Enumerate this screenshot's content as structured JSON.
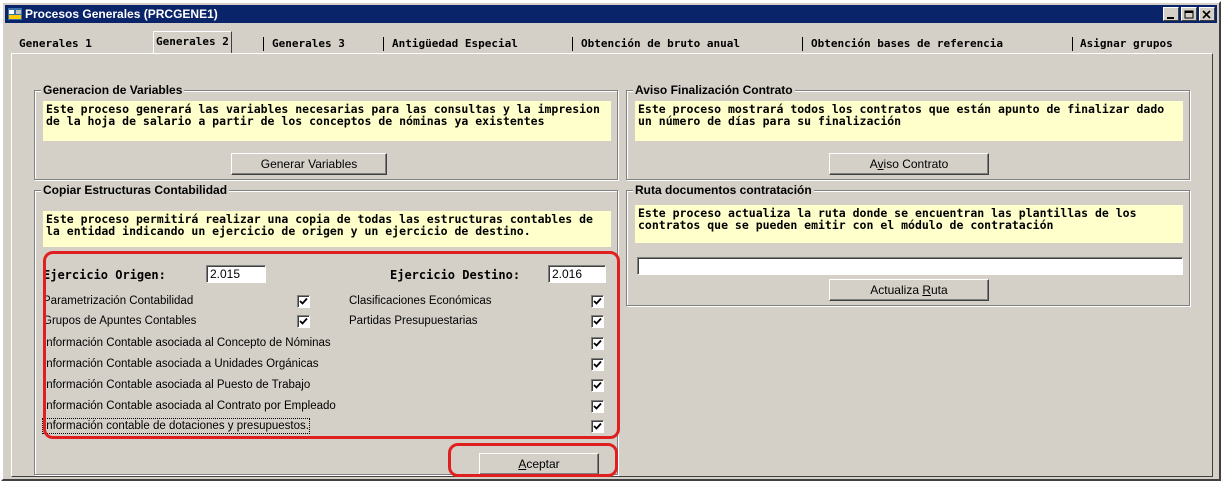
{
  "window": {
    "title": "Procesos Generales (PRCGENE1)"
  },
  "tabs": [
    "Generales 1",
    "Generales 2",
    "Generales 3",
    "Antigüedad Especial",
    "Obtención de bruto anual",
    "Obtención bases de referencia",
    "Asignar grupos"
  ],
  "generacion": {
    "title": "Generacion de Variables",
    "note": "Este proceso generará las variables necesarias para las consultas y la impresion de la hoja de salario a partir de los conceptos de nóminas ya existentes",
    "button": "Generar Variables"
  },
  "aviso": {
    "title": "Aviso Finalización Contrato",
    "note": "Este proceso mostrará todos los contratos que están apunto de finalizar dado un número de días para su finalización",
    "button_pre": "A",
    "button_acc": "v",
    "button_post": "iso Contrato"
  },
  "copiar": {
    "title": "Copiar Estructuras Contabilidad",
    "note": "Este proceso permitirá realizar una copia de todas las estructuras contables de la entidad indicando un ejercicio de origen y un ejercicio de destino.",
    "origen_label": "Ejercicio Origen:",
    "origen_value": "2.015",
    "destino_label": "Ejercicio Destino:",
    "destino_value": "2.016",
    "items": [
      {
        "label": "Parametrización Contabilidad",
        "checked": true
      },
      {
        "label": "Clasificaciones Económicas",
        "checked": true
      },
      {
        "label": "Grupos de Apuntes Contables",
        "checked": true
      },
      {
        "label": "Partidas Presupuestarias",
        "checked": true
      },
      {
        "label": "Información Contable asociada al Concepto de Nóminas",
        "checked": true
      },
      {
        "label": "Información Contable asociada a Unidades Orgánicas",
        "checked": true
      },
      {
        "label": "Información Contable asociada al Puesto de Trabajo",
        "checked": true
      },
      {
        "label": "Información Contable asociada al Contrato por Empleado",
        "checked": true
      },
      {
        "label": "Información contable de dotaciones y presupuestos.",
        "checked": true
      }
    ],
    "accept_acc": "A",
    "accept_post": "ceptar"
  },
  "ruta": {
    "title": "Ruta documentos contratación",
    "note": "Este proceso actualiza la ruta donde se encuentran las plantillas de los contratos que se pueden emitir con el módulo de contratación",
    "path_value": "",
    "button_pre": "Actualiza ",
    "button_acc": "R",
    "button_post": "uta"
  }
}
